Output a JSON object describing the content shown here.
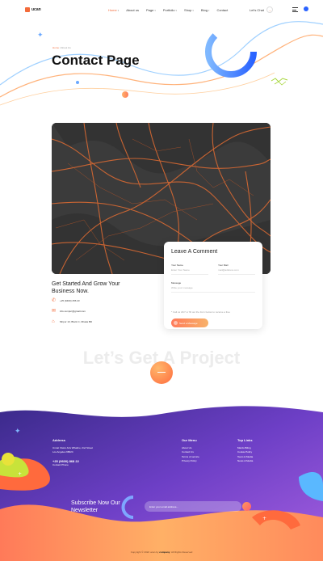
{
  "brand": {
    "name": "ucan"
  },
  "nav": {
    "items": [
      {
        "label": "Home",
        "active": true
      },
      {
        "label": "About us"
      },
      {
        "label": "Page"
      },
      {
        "label": "Portfolio"
      },
      {
        "label": "Shop"
      },
      {
        "label": "Blog"
      },
      {
        "label": "Contact"
      }
    ],
    "chat_label": "Let's Chat"
  },
  "hero": {
    "breadcrumb_home": "Home",
    "breadcrumb_sep": "/",
    "breadcrumb_current": "About Us",
    "title": "Contact Page"
  },
  "comment": {
    "title": "Leave A Comment",
    "name_label": "Your Name",
    "name_placeholder": "Enter Your Name",
    "mail_label": "Your Mail",
    "mail_placeholder": "mail@address.com",
    "message_label": "Message",
    "message_placeholder": "Write your message",
    "note": "* Call us 24/7 or fill out the form below to receive a free",
    "send_label": "Send a Message"
  },
  "contact": {
    "heading": "Get Started And Grow Your Business Now.",
    "phone": "+25 (9400) 456 23",
    "email": "info.rempur@gmail.com",
    "address": "Mirpur 13, Block C, Dhaka BD"
  },
  "project": {
    "heading": "Let’s Get A Project"
  },
  "footer": {
    "address_title": "Address",
    "address_text_1": "Unnat Vision Arts Whalicu, 2nd Street",
    "address_text_2": "Los Angeles 98024",
    "phone": "+25 (9600) 868 22",
    "contact_phone_label": "Contact Phone",
    "menu_title": "Our Menu",
    "menu": [
      "About Us",
      "Contact Us",
      "Terms of service",
      "Privacy Policy"
    ],
    "links_title": "Top Links",
    "links": [
      "Mardo Biling",
      "Cookie Policy",
      "Team & Media",
      "News & Media"
    ],
    "subscribe_heading": "Subscribe Now Our Newsletter",
    "subscribe_placeholder": "Enter your email address...",
    "copyright_pre": "Copyright © 2022 ucan by",
    "copyright_brand": "company",
    "copyright_post": ". All Rights Reserved"
  },
  "colors": {
    "accent": "#f36b3a",
    "blue": "#2a63ff",
    "purple": "#7b4fd6"
  }
}
